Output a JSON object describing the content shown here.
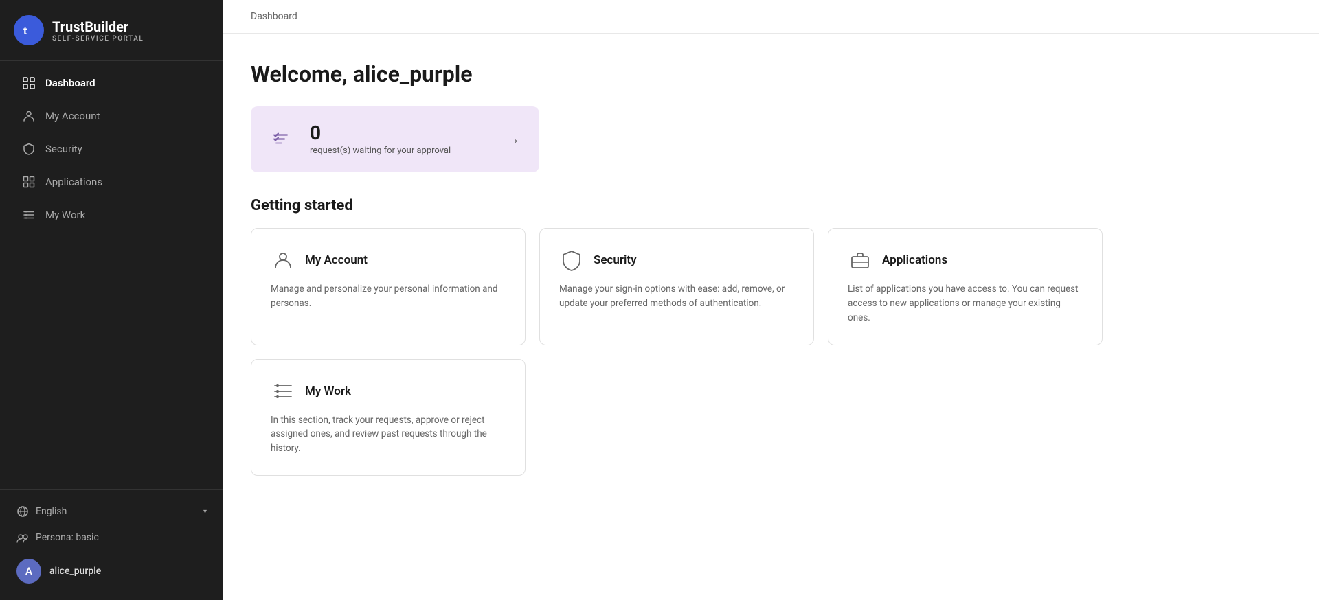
{
  "brand": {
    "logo_letter": "t",
    "title": "TrustBuilder",
    "subtitle": "SELF-SERVICE PORTAL"
  },
  "sidebar": {
    "nav_items": [
      {
        "id": "dashboard",
        "label": "Dashboard",
        "icon": "dashboard-icon",
        "active": true
      },
      {
        "id": "my-account",
        "label": "My Account",
        "icon": "person-icon",
        "active": false
      },
      {
        "id": "security",
        "label": "Security",
        "icon": "shield-icon",
        "active": false
      },
      {
        "id": "applications",
        "label": "Applications",
        "icon": "grid-icon",
        "active": false
      },
      {
        "id": "my-work",
        "label": "My Work",
        "icon": "list-icon",
        "active": false
      }
    ],
    "language": "English",
    "persona_label": "Persona: basic",
    "user_name": "alice_purple",
    "user_initial": "A"
  },
  "header": {
    "breadcrumb": "Dashboard"
  },
  "main": {
    "welcome_text": "Welcome, alice_purple",
    "approval_count": "0",
    "approval_label": "request(s) waiting for your approval",
    "getting_started_heading": "Getting started",
    "cards": [
      {
        "id": "my-account",
        "title": "My Account",
        "description": "Manage and personalize your personal information and personas.",
        "icon": "person-card-icon"
      },
      {
        "id": "security",
        "title": "Security",
        "description": "Manage your sign-in options with ease: add, remove, or update your preferred methods of authentication.",
        "icon": "shield-card-icon"
      },
      {
        "id": "applications",
        "title": "Applications",
        "description": "List of applications you have access to. You can request access to new applications or manage your existing ones.",
        "icon": "briefcase-card-icon"
      }
    ],
    "bottom_cards": [
      {
        "id": "my-work",
        "title": "My Work",
        "description": "In this section, track your requests, approve or reject assigned ones, and review past requests through the history.",
        "icon": "mywork-card-icon"
      }
    ]
  }
}
